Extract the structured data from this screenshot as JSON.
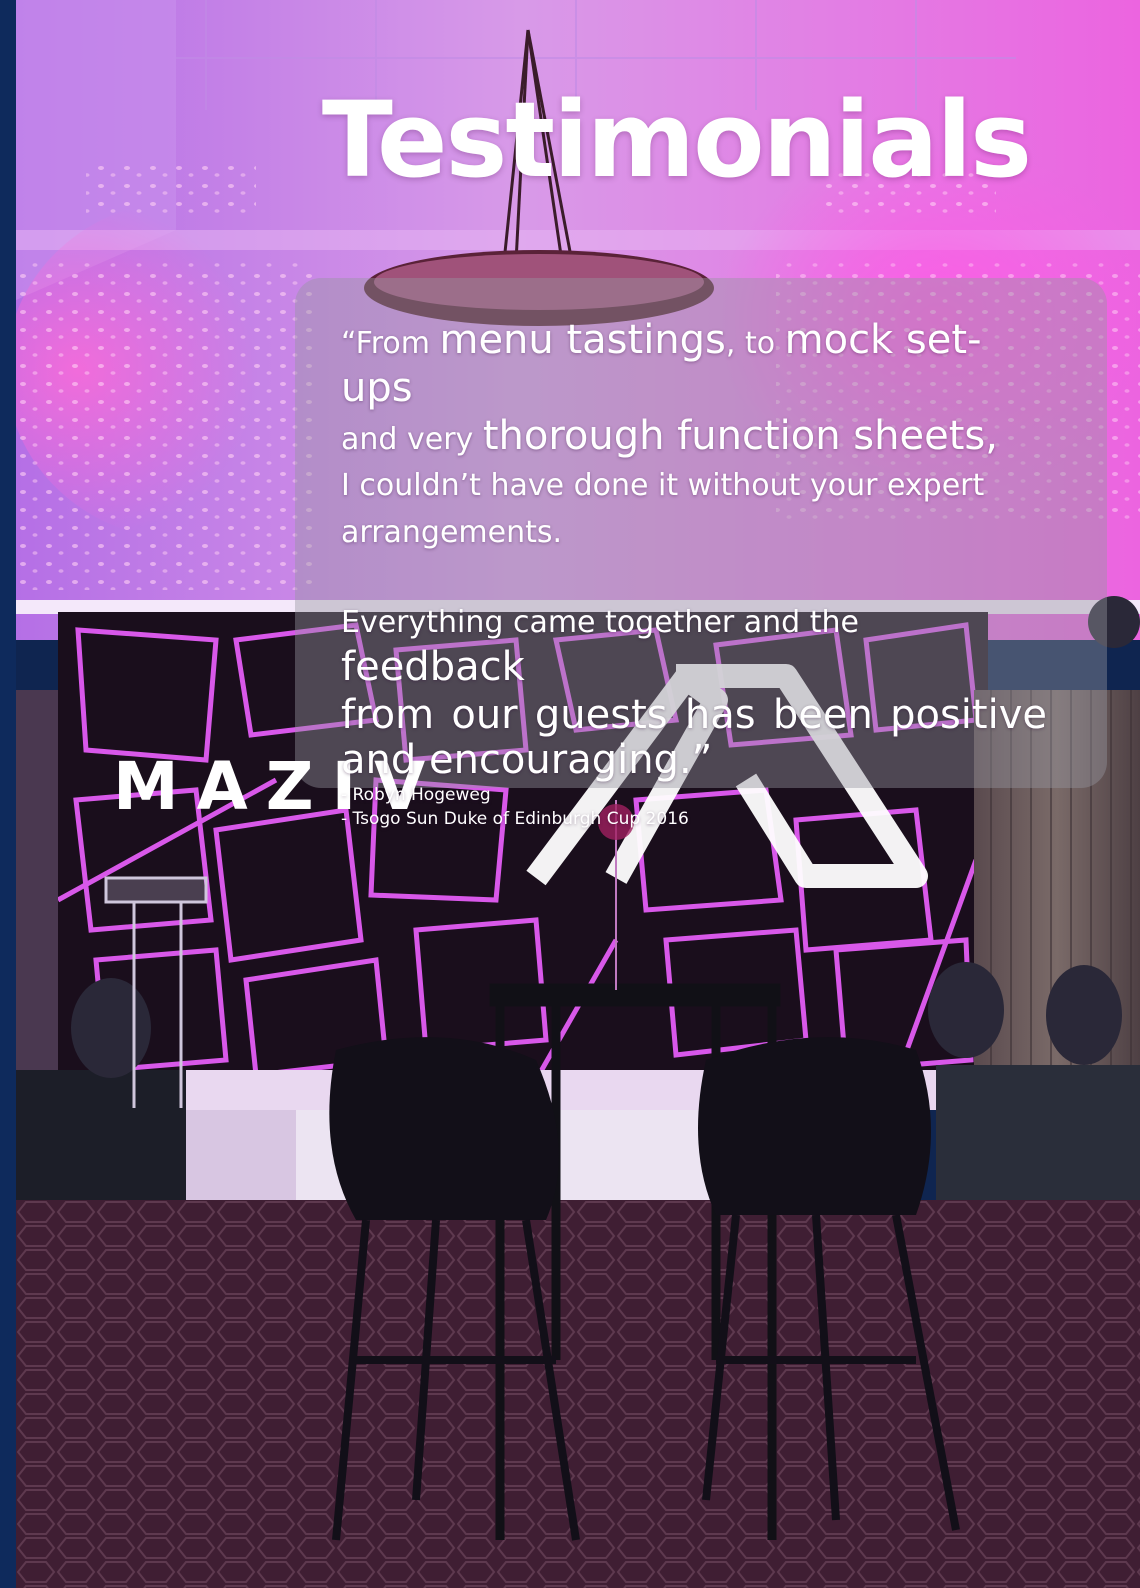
{
  "page": {
    "title": "Testimonials"
  },
  "testimonial": {
    "line1_a": "“From ",
    "line1_b": "menu tastings",
    "line1_c": ", to ",
    "line1_d": "mock set-ups",
    "line2_a": "and very ",
    "line2_b": "thorough function sheets",
    "line2_c": ",",
    "line3": "I couldn’t have done it without your expert",
    "line4": "arrangements.",
    "line5_a": "Everything came together and the ",
    "line5_b": "feedback",
    "line6": "from our guests has been positive",
    "line7": "and encouraging.”",
    "author": "- Robyn Hogeweg",
    "event": "- Tsogo Sun Duke of Edinburgh Cup 2016"
  },
  "brand": {
    "wordmark": "MAZIV",
    "logo_icon": "maziv-mountain-logo-icon"
  },
  "colors": {
    "accent_magenta": "#e04cf0",
    "side_bar_navy": "#0e2a5c"
  }
}
